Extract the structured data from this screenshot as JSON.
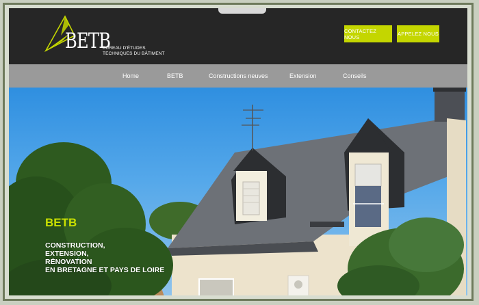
{
  "header": {
    "logo_text": "BETB",
    "logo_subtitle_line1": "BUREAU D'ÉTUDES",
    "logo_subtitle_line2": "TECHNIQUES DU BÂTIMENT",
    "contact_button": "CONTACTEZ NOUS",
    "call_button": "APPELEZ NOUS"
  },
  "nav": {
    "items": [
      {
        "label": "Home"
      },
      {
        "label": "BETB"
      },
      {
        "label": "Constructions neuves"
      },
      {
        "label": "Extension"
      },
      {
        "label": "Conseils"
      }
    ]
  },
  "hero": {
    "title": "BETB",
    "lines": [
      "CONSTRUCTION,",
      "EXTENSION,",
      "RÉNOVATION",
      "EN BRETAGNE ET PAYS DE LOIRE"
    ]
  },
  "colors": {
    "accent": "#c4d600",
    "header_bg": "#262626",
    "nav_bg": "#9a9a9a",
    "frame": "#6e7a5c"
  }
}
